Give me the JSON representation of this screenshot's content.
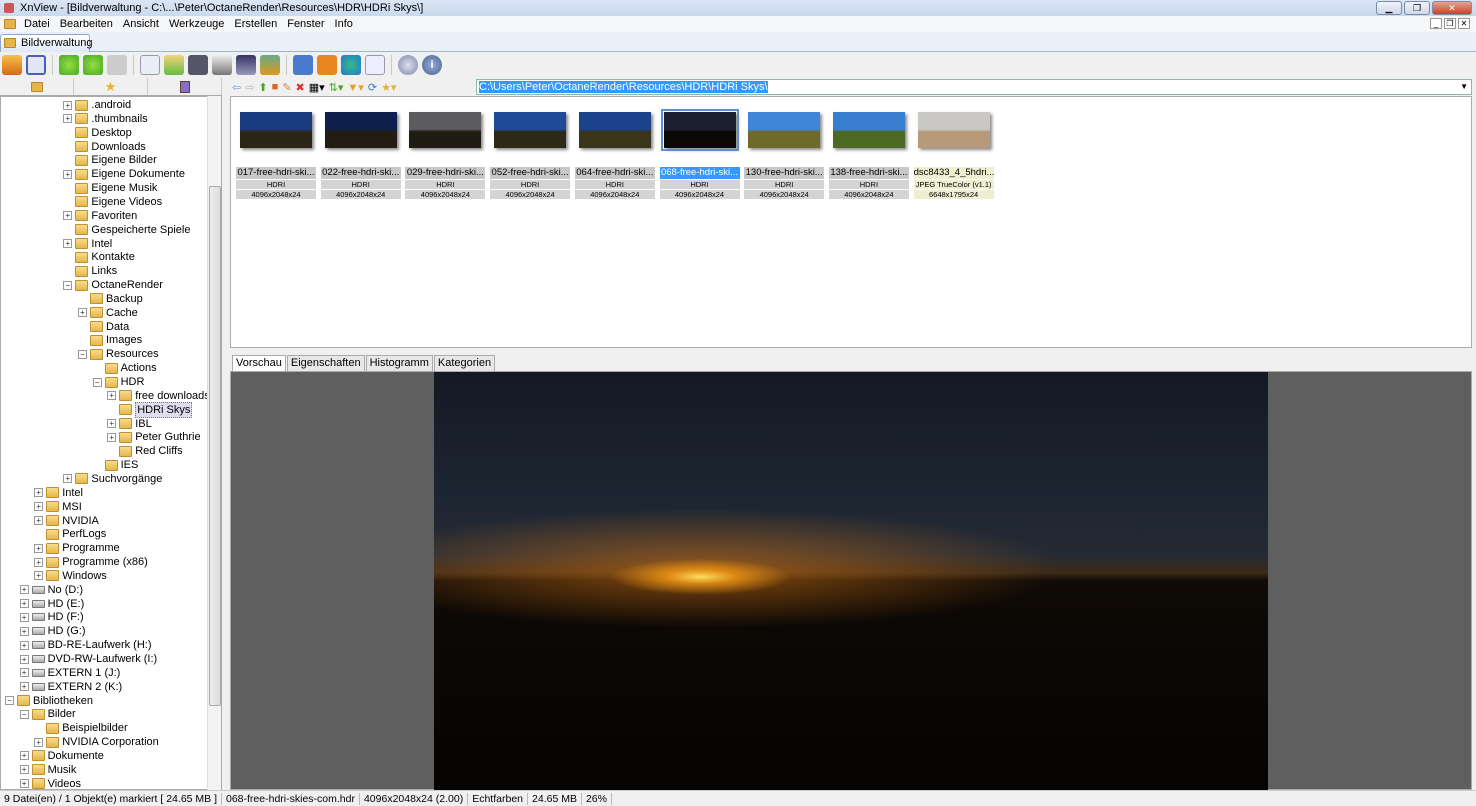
{
  "window": {
    "title": "XnView - [Bildverwaltung - C:\\...\\Peter\\OctaneRender\\Resources\\HDR\\HDRi Skys\\]"
  },
  "menu": [
    "Datei",
    "Bearbeiten",
    "Ansicht",
    "Werkzeuge",
    "Erstellen",
    "Fenster",
    "Info"
  ],
  "doc_tab": "Bildverwaltung",
  "path": "C:\\Users\\Peter\\OctaneRender\\Resources\\HDR\\HDRi Skys\\",
  "tree": [
    {
      "label": ".android",
      "level": 4,
      "exp": true
    },
    {
      "label": ".thumbnails",
      "level": 4,
      "exp": true
    },
    {
      "label": "Desktop",
      "level": 4
    },
    {
      "label": "Downloads",
      "level": 4
    },
    {
      "label": "Eigene Bilder",
      "level": 4
    },
    {
      "label": "Eigene Dokumente",
      "level": 4,
      "exp": true
    },
    {
      "label": "Eigene Musik",
      "level": 4
    },
    {
      "label": "Eigene Videos",
      "level": 4
    },
    {
      "label": "Favoriten",
      "level": 4,
      "exp": true
    },
    {
      "label": "Gespeicherte Spiele",
      "level": 4
    },
    {
      "label": "Intel",
      "level": 4,
      "exp": true
    },
    {
      "label": "Kontakte",
      "level": 4
    },
    {
      "label": "Links",
      "level": 4
    },
    {
      "label": "OctaneRender",
      "level": 4,
      "exp": true,
      "open": true
    },
    {
      "label": "Backup",
      "level": 5
    },
    {
      "label": "Cache",
      "level": 5,
      "exp": true
    },
    {
      "label": "Data",
      "level": 5
    },
    {
      "label": "Images",
      "level": 5
    },
    {
      "label": "Resources",
      "level": 5,
      "exp": true,
      "open": true
    },
    {
      "label": "Actions",
      "level": 6
    },
    {
      "label": "HDR",
      "level": 6,
      "exp": true,
      "open": true
    },
    {
      "label": "free downloads",
      "level": 7,
      "exp": true
    },
    {
      "label": "HDRi Skys",
      "level": 7,
      "selected": true
    },
    {
      "label": "IBL",
      "level": 7,
      "exp": true
    },
    {
      "label": "Peter Guthrie",
      "level": 7,
      "exp": true
    },
    {
      "label": "Red Cliffs",
      "level": 7
    },
    {
      "label": "IES",
      "level": 6
    },
    {
      "label": "Suchvorgänge",
      "level": 4,
      "exp": true
    },
    {
      "label": "Intel",
      "level": 2,
      "exp": true
    },
    {
      "label": "MSI",
      "level": 2,
      "exp": true
    },
    {
      "label": "NVIDIA",
      "level": 2,
      "exp": true
    },
    {
      "label": "PerfLogs",
      "level": 2
    },
    {
      "label": "Programme",
      "level": 2,
      "exp": true
    },
    {
      "label": "Programme (x86)",
      "level": 2,
      "exp": true
    },
    {
      "label": "Windows",
      "level": 2,
      "exp": true
    },
    {
      "label": "No (D:)",
      "level": 1,
      "exp": true,
      "drive": true
    },
    {
      "label": "HD (E:)",
      "level": 1,
      "exp": true,
      "drive": true
    },
    {
      "label": "HD (F:)",
      "level": 1,
      "exp": true,
      "drive": true
    },
    {
      "label": "HD (G:)",
      "level": 1,
      "exp": true,
      "drive": true
    },
    {
      "label": "BD-RE-Laufwerk (H:)",
      "level": 1,
      "exp": true,
      "drive": true
    },
    {
      "label": "DVD-RW-Laufwerk (I:)",
      "level": 1,
      "exp": true,
      "drive": true
    },
    {
      "label": "EXTERN 1 (J:)",
      "level": 1,
      "exp": true,
      "drive": true
    },
    {
      "label": "EXTERN 2 (K:)",
      "level": 1,
      "exp": true,
      "drive": true
    },
    {
      "label": "Bibliotheken",
      "level": 0,
      "exp": true,
      "open": true
    },
    {
      "label": "Bilder",
      "level": 1,
      "exp": true,
      "open": true
    },
    {
      "label": "Beispielbilder",
      "level": 2
    },
    {
      "label": "NVIDIA Corporation",
      "level": 2,
      "exp": true
    },
    {
      "label": "Dokumente",
      "level": 1,
      "exp": true
    },
    {
      "label": "Musik",
      "level": 1,
      "exp": true
    },
    {
      "label": "Videos",
      "level": 1,
      "exp": true
    }
  ],
  "thumbnails": [
    {
      "name": "017-free-hdri-ski...",
      "type": "HDRI",
      "dims": "4096x2048x24",
      "colors": [
        "#1a3a80",
        "#2b2516"
      ]
    },
    {
      "name": "022-free-hdri-ski...",
      "type": "HDRI",
      "dims": "4096x2048x24",
      "colors": [
        "#0e1f4c",
        "#211d12"
      ]
    },
    {
      "name": "029-free-hdri-ski...",
      "type": "HDRI",
      "dims": "4096x2048x24",
      "colors": [
        "#5b5b60",
        "#1f1c14"
      ]
    },
    {
      "name": "052-free-hdri-ski...",
      "type": "HDRI",
      "dims": "4096x2048x24",
      "colors": [
        "#1f4a98",
        "#2c2a16"
      ]
    },
    {
      "name": "064-free-hdri-ski...",
      "type": "HDRI",
      "dims": "4096x2048x24",
      "colors": [
        "#1c428c",
        "#3a3418"
      ]
    },
    {
      "name": "068-free-hdri-ski...",
      "type": "HDRI",
      "dims": "4096x2048x24",
      "colors": [
        "#1a2030",
        "#0b0906"
      ],
      "selected": true
    },
    {
      "name": "130-free-hdri-ski...",
      "type": "HDRI",
      "dims": "4096x2048x24",
      "colors": [
        "#3f86d8",
        "#6d6a2a"
      ]
    },
    {
      "name": "138-free-hdri-ski...",
      "type": "HDRI",
      "dims": "4096x2048x24",
      "colors": [
        "#3a7ed0",
        "#4c6a24"
      ]
    },
    {
      "name": "dsc8433_4_5hdri...",
      "type": "JPEG TrueColor (v1.1)",
      "dims": "6648x1795x24",
      "colors": [
        "#c9c8c4",
        "#b89a7a"
      ],
      "jpg": true
    }
  ],
  "preview_tabs": [
    "Vorschau",
    "Eigenschaften",
    "Histogramm",
    "Kategorien"
  ],
  "status": [
    "9 Datei(en) / 1 Objekt(e) markiert  [ 24.65 MB ]",
    "068-free-hdri-skies-com.hdr",
    "4096x2048x24 (2.00)",
    "Echtfarben",
    "24.65 MB",
    "26%"
  ]
}
